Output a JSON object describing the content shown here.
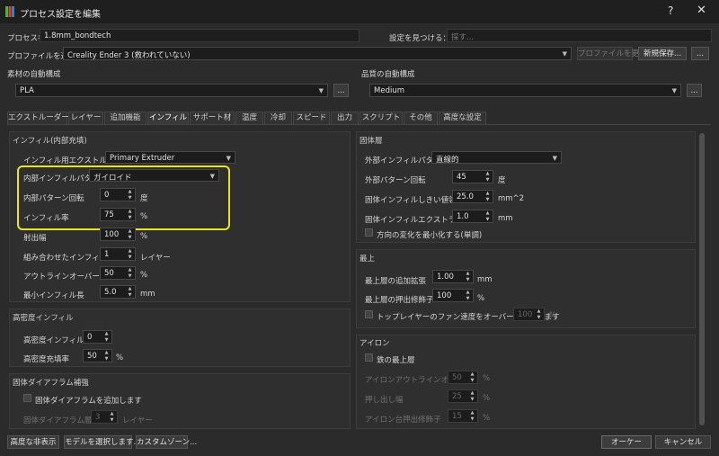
{
  "window": {
    "title": "プロセス設定を編集",
    "help": "?",
    "close": "✕"
  },
  "process_name": {
    "label": "プロセス名",
    "value": "1.8mm_bondtech"
  },
  "find_setting": {
    "label": "設定を見つける：",
    "placeholder": "探す..."
  },
  "profile": {
    "label": "プロファイルを選択",
    "value": "Creality Ender 3 (救われていない)",
    "update_label": "プロファイルを更新",
    "save_new_label": "新規保存...",
    "more_label": "..."
  },
  "material": {
    "label": "素材の自動構成",
    "value": "PLA",
    "more_label": "..."
  },
  "quality": {
    "label": "品質の自動構成",
    "value": "Medium",
    "more_label": "..."
  },
  "tabs": [
    {
      "label": "エクストルーダー"
    },
    {
      "label": "レイヤー"
    },
    {
      "label": "追加機能"
    },
    {
      "label": "インフィル",
      "active": true
    },
    {
      "label": "サポート材"
    },
    {
      "label": "温度"
    },
    {
      "label": "冷却"
    },
    {
      "label": "スピード"
    },
    {
      "label": "出力"
    },
    {
      "label": "スクリプト"
    },
    {
      "label": "その他"
    },
    {
      "label": "高度な設定"
    }
  ],
  "internal_infill": {
    "title": "インフィル(内部充填)",
    "extruder": {
      "label": "インフィル用エクストルーダー",
      "value": "Primary Extruder"
    },
    "pattern": {
      "label": "内部インフィルパターン",
      "value": "ガイロイド"
    },
    "rotation": {
      "label": "内部パターン回転",
      "value": "0",
      "unit": "度"
    },
    "rate": {
      "label": "インフィル率",
      "value": "75",
      "unit": "%"
    },
    "outline_overlap_width": {
      "label": "射出幅",
      "value": "100",
      "unit": "%"
    },
    "combine_layers": {
      "label": "組み合わせたインフィル層",
      "value": "1",
      "unit": "レイヤー"
    },
    "outline_overlap": {
      "label": "アウトラインオーバーラップ",
      "value": "50",
      "unit": "%"
    },
    "min_length": {
      "label": "最小インフィル長",
      "value": "5.0",
      "unit": "mm"
    }
  },
  "dense_infill": {
    "title": "高密度インフィル",
    "layers": {
      "label": "高密度インフィル層",
      "value": "0"
    },
    "rate": {
      "label": "高密度充填率",
      "value": "50",
      "unit": "%"
    }
  },
  "diaphragm": {
    "title": "固体ダイアフラム補強",
    "add": {
      "label": "固体ダイアフラムを追加します"
    },
    "layers": {
      "label": "固体ダイアフラム層",
      "value": "3",
      "unit": "レイヤー"
    }
  },
  "solid_layers": {
    "title": "固体層",
    "external_pattern": {
      "label": "外部インフィルパターン",
      "value": "直線的"
    },
    "external_rotation": {
      "label": "外部パターン回転",
      "value": "45",
      "unit": "度"
    },
    "threshold": {
      "label": "固体インフィルしきい値領域",
      "value": "25.0",
      "unit": "mm^2"
    },
    "extrusion": {
      "label": "固体インフィルエクストラ拡張",
      "value": "1.0",
      "unit": "mm"
    },
    "minimize_change": {
      "label": "方向の変化を最小化する(単調)"
    }
  },
  "top": {
    "title": "最上",
    "extra_extension": {
      "label": "最上層の追加拡張",
      "value": "1.00",
      "unit": "mm"
    },
    "flow_multiplier": {
      "label": "最上層の押出修飾子",
      "value": "100",
      "unit": "%"
    },
    "fan_override": {
      "label": "トップレイヤーのファン速度をオーバーライドします",
      "value": "100",
      "unit": "%"
    }
  },
  "ironing": {
    "title": "アイロン",
    "only_top": {
      "label": "鉄の最上層"
    },
    "outline_offset": {
      "label": "アイロンアウトラインオフセット",
      "value": "50",
      "unit": "%"
    },
    "extrusion_width": {
      "label": "押し出し幅",
      "value": "25",
      "unit": "%"
    },
    "flow": {
      "label": "アイロン台押出修飾子",
      "value": "15",
      "unit": "%"
    }
  },
  "footer": {
    "hide_advanced": "高度な非表示",
    "select_models": "モデルを選択します...",
    "custom_zones": "カスタムゾーン...",
    "ok": "オーケー",
    "cancel": "キャンセル"
  },
  "colors": {
    "highlight": "#e9e32a",
    "background": "#2b2b2b",
    "titlebar": "#1f1f1f"
  }
}
